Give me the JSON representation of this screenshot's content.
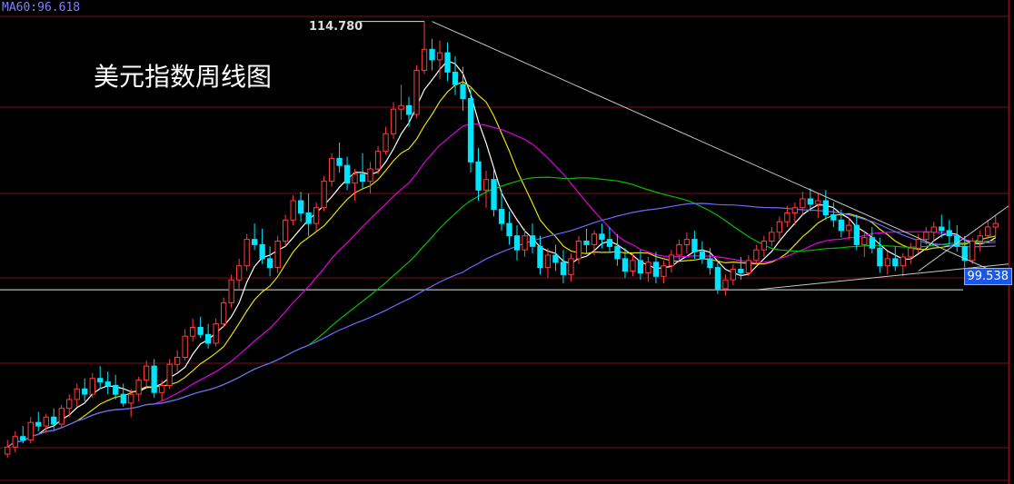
{
  "ma_indicator": {
    "text": "MA60:96.618",
    "color": "#8080ff"
  },
  "title": "美元指数周线图",
  "high_label": "114.780",
  "current_price_label": "99.538",
  "colors": {
    "background": "#000000",
    "grid": "#7a1010",
    "candle_up": "#ff3c3c",
    "candle_down": "#00e5ff",
    "ma5": "#ffffff",
    "ma10": "#e8e000",
    "ma20": "#e000e0",
    "ma40": "#00c000",
    "ma60": "#6a6aff",
    "trendline": "#c8c8c8",
    "price_tag": "#1a56e8"
  },
  "chart_data": {
    "type": "candlestick",
    "title": "美元指数周线图",
    "series_names": [
      "MA60"
    ],
    "ylim": [
      88.5,
      116
    ],
    "high": 114.78,
    "current_price": 99.538,
    "ma60_last": 96.618,
    "grid": true,
    "candles": [
      [
        90.2,
        91.0,
        90.0,
        90.6
      ],
      [
        90.6,
        91.5,
        90.3,
        91.2
      ],
      [
        91.2,
        91.8,
        90.8,
        91.0
      ],
      [
        91.0,
        92.3,
        90.8,
        92.0
      ],
      [
        92.0,
        92.6,
        91.5,
        91.8
      ],
      [
        91.8,
        92.5,
        91.4,
        92.3
      ],
      [
        92.3,
        92.8,
        91.6,
        91.9
      ],
      [
        91.9,
        93.0,
        91.7,
        92.8
      ],
      [
        92.8,
        93.6,
        92.3,
        93.3
      ],
      [
        93.3,
        94.2,
        92.9,
        93.9
      ],
      [
        93.9,
        94.5,
        93.2,
        93.6
      ],
      [
        93.6,
        94.8,
        93.4,
        94.5
      ],
      [
        94.5,
        95.2,
        93.9,
        94.3
      ],
      [
        94.3,
        94.9,
        93.6,
        94.1
      ],
      [
        94.1,
        94.7,
        93.3,
        93.6
      ],
      [
        93.6,
        94.2,
        92.9,
        93.1
      ],
      [
        93.1,
        93.9,
        92.3,
        93.6
      ],
      [
        93.6,
        94.6,
        93.2,
        94.4
      ],
      [
        94.4,
        95.5,
        94.0,
        95.2
      ],
      [
        95.2,
        95.6,
        93.4,
        93.7
      ],
      [
        93.7,
        94.4,
        93.2,
        94.1
      ],
      [
        94.1,
        95.6,
        93.9,
        95.3
      ],
      [
        95.3,
        96.1,
        94.9,
        95.7
      ],
      [
        95.7,
        97.3,
        95.5,
        96.9
      ],
      [
        96.9,
        97.9,
        96.6,
        97.4
      ],
      [
        97.4,
        98.0,
        96.8,
        97.0
      ],
      [
        97.0,
        97.6,
        96.2,
        96.5
      ],
      [
        96.5,
        97.9,
        96.3,
        97.6
      ],
      [
        97.6,
        99.1,
        97.4,
        98.8
      ],
      [
        98.8,
        100.4,
        98.5,
        100.1
      ],
      [
        100.1,
        101.3,
        99.6,
        100.9
      ],
      [
        100.9,
        102.7,
        100.6,
        102.4
      ],
      [
        102.4,
        103.3,
        101.8,
        102.1
      ],
      [
        102.1,
        103.0,
        101.0,
        101.3
      ],
      [
        101.3,
        102.0,
        100.3,
        100.8
      ],
      [
        100.8,
        102.6,
        100.5,
        102.3
      ],
      [
        102.3,
        103.8,
        102.0,
        103.5
      ],
      [
        103.5,
        104.9,
        103.2,
        104.6
      ],
      [
        104.6,
        105.1,
        103.4,
        103.9
      ],
      [
        103.9,
        105.0,
        102.6,
        103.3
      ],
      [
        103.3,
        104.5,
        102.9,
        104.2
      ],
      [
        104.2,
        106.0,
        104.0,
        105.7
      ],
      [
        105.7,
        107.3,
        105.4,
        107.0
      ],
      [
        107.0,
        107.9,
        106.2,
        106.6
      ],
      [
        106.6,
        107.1,
        105.2,
        105.6
      ],
      [
        105.6,
        106.4,
        104.6,
        106.1
      ],
      [
        106.1,
        107.3,
        105.3,
        105.7
      ],
      [
        105.7,
        106.8,
        105.0,
        106.4
      ],
      [
        106.4,
        107.7,
        106.1,
        107.4
      ],
      [
        107.4,
        108.8,
        107.2,
        108.4
      ],
      [
        108.4,
        110.2,
        108.1,
        109.8
      ],
      [
        109.8,
        111.2,
        109.2,
        110.0
      ],
      [
        110.0,
        110.5,
        108.8,
        109.5
      ],
      [
        109.5,
        112.3,
        109.3,
        112.0
      ],
      [
        112.0,
        114.78,
        111.8,
        113.2
      ],
      [
        113.2,
        113.8,
        112.0,
        112.6
      ],
      [
        112.6,
        113.7,
        111.5,
        113.0
      ],
      [
        113.0,
        113.6,
        111.4,
        111.9
      ],
      [
        111.9,
        112.8,
        110.6,
        111.2
      ],
      [
        111.2,
        112.2,
        109.7,
        110.4
      ],
      [
        110.4,
        111.0,
        106.2,
        106.8
      ],
      [
        106.8,
        107.6,
        104.6,
        105.2
      ],
      [
        105.2,
        106.3,
        104.2,
        105.8
      ],
      [
        105.8,
        106.4,
        103.7,
        104.1
      ],
      [
        104.1,
        105.2,
        102.9,
        103.3
      ],
      [
        103.3,
        104.0,
        102.1,
        102.6
      ],
      [
        102.6,
        103.2,
        101.2,
        101.8
      ],
      [
        101.8,
        103.0,
        101.4,
        102.6
      ],
      [
        102.6,
        103.3,
        101.6,
        102.0
      ],
      [
        102.0,
        102.6,
        100.4,
        100.8
      ],
      [
        100.8,
        101.9,
        100.2,
        101.5
      ],
      [
        101.5,
        102.1,
        100.6,
        101.1
      ],
      [
        101.1,
        101.8,
        99.9,
        100.4
      ],
      [
        100.4,
        101.6,
        100.0,
        101.3
      ],
      [
        101.3,
        102.6,
        101.0,
        102.3
      ],
      [
        102.3,
        103.0,
        101.6,
        102.1
      ],
      [
        102.1,
        102.9,
        101.5,
        102.7
      ],
      [
        102.7,
        103.3,
        101.9,
        102.4
      ],
      [
        102.4,
        103.1,
        101.7,
        102.0
      ],
      [
        102.0,
        102.7,
        100.9,
        101.3
      ],
      [
        101.3,
        101.9,
        100.2,
        100.6
      ],
      [
        100.6,
        101.6,
        100.3,
        101.2
      ],
      [
        101.2,
        101.8,
        100.1,
        100.5
      ],
      [
        100.5,
        101.4,
        100.0,
        101.1
      ],
      [
        101.1,
        101.7,
        99.9,
        100.3
      ],
      [
        100.3,
        101.2,
        99.9,
        100.9
      ],
      [
        100.9,
        101.8,
        100.5,
        101.5
      ],
      [
        101.5,
        102.4,
        101.2,
        102.1
      ],
      [
        102.1,
        102.8,
        101.6,
        102.4
      ],
      [
        102.4,
        102.9,
        101.3,
        101.7
      ],
      [
        101.7,
        102.3,
        101.0,
        101.3
      ],
      [
        101.3,
        101.9,
        100.4,
        100.8
      ],
      [
        100.8,
        101.1,
        99.3,
        99.6
      ],
      [
        99.6,
        100.4,
        99.2,
        100.1
      ],
      [
        100.1,
        101.0,
        99.8,
        100.7
      ],
      [
        100.7,
        101.4,
        100.1,
        100.5
      ],
      [
        100.5,
        101.5,
        100.3,
        101.2
      ],
      [
        101.2,
        102.1,
        101.0,
        101.8
      ],
      [
        101.8,
        102.6,
        101.4,
        102.3
      ],
      [
        102.3,
        103.1,
        102.0,
        102.8
      ],
      [
        102.8,
        103.7,
        102.4,
        103.4
      ],
      [
        103.4,
        104.3,
        103.1,
        103.9
      ],
      [
        103.9,
        104.5,
        103.2,
        104.2
      ],
      [
        104.2,
        105.1,
        103.8,
        104.7
      ],
      [
        104.7,
        105.3,
        104.0,
        104.4
      ],
      [
        104.4,
        105.0,
        103.6,
        104.6
      ],
      [
        104.6,
        105.2,
        103.5,
        103.8
      ],
      [
        103.8,
        104.5,
        103.1,
        103.5
      ],
      [
        103.5,
        104.1,
        102.5,
        102.9
      ],
      [
        102.9,
        103.6,
        102.4,
        103.2
      ],
      [
        103.2,
        103.8,
        101.8,
        102.1
      ],
      [
        102.1,
        102.9,
        101.4,
        102.5
      ],
      [
        102.5,
        103.1,
        101.6,
        101.9
      ],
      [
        101.9,
        102.5,
        100.5,
        100.9
      ],
      [
        100.9,
        101.7,
        100.4,
        101.3
      ],
      [
        101.3,
        102.0,
        100.6,
        100.9
      ],
      [
        100.9,
        101.6,
        100.3,
        101.4
      ],
      [
        101.4,
        102.2,
        101.0,
        101.9
      ],
      [
        101.9,
        102.7,
        101.6,
        102.4
      ],
      [
        102.4,
        103.1,
        102.1,
        102.8
      ],
      [
        102.8,
        103.4,
        102.3,
        103.1
      ],
      [
        103.1,
        103.8,
        102.5,
        102.9
      ],
      [
        102.9,
        103.5,
        102.1,
        102.6
      ],
      [
        102.6,
        103.2,
        101.7,
        102.0
      ],
      [
        102.0,
        102.6,
        100.8,
        101.2
      ],
      [
        101.2,
        102.5,
        101.0,
        102.3
      ],
      [
        102.3,
        102.9,
        101.7,
        102.6
      ],
      [
        102.6,
        103.5,
        102.4,
        103.1
      ],
      [
        103.1,
        103.8,
        102.6,
        103.3
      ]
    ],
    "trendlines": [
      {
        "from": [
          55,
          114.78
        ],
        "to": [
          141,
          100.2
        ]
      },
      {
        "from": [
          97,
          99.538
        ],
        "to": [
          141,
          101.0
        ]
      },
      {
        "from": [
          118,
          100.6
        ],
        "to": [
          141,
          104.3
        ]
      }
    ],
    "horizontal_line": 99.538
  }
}
